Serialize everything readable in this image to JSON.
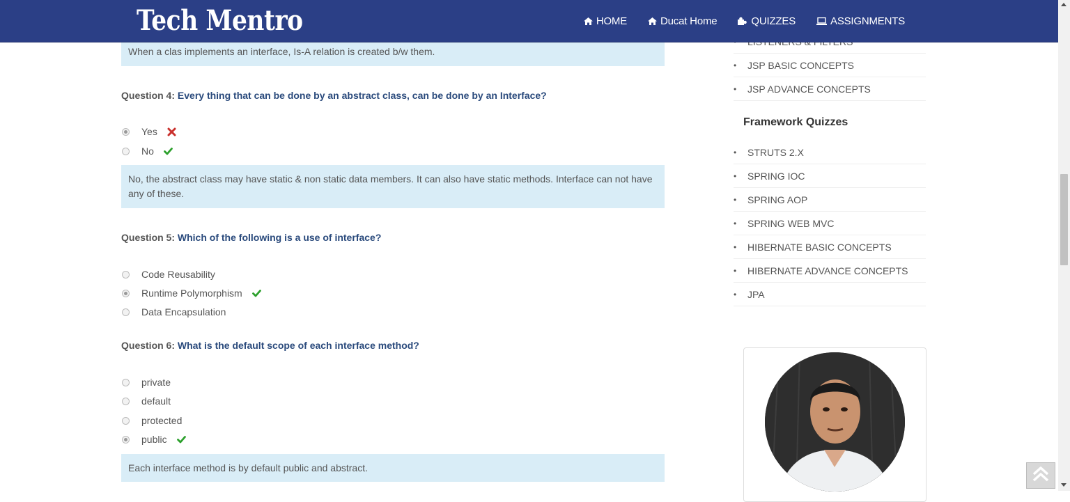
{
  "brand": "Tech Mentro",
  "nav": [
    {
      "label": "HOME",
      "icon": "home-icon"
    },
    {
      "label": "Ducat Home",
      "icon": "home-icon"
    },
    {
      "label": "QUIZZES",
      "icon": "puzzle-icon"
    },
    {
      "label": "ASSIGNMENTS",
      "icon": "laptop-icon"
    }
  ],
  "top_explanation": "When a clas implements an interface, Is-A relation is created b/w them.",
  "q4": {
    "num": "Question 4:",
    "text": "Every thing that can be done by an abstract class, can be done by an Interface?",
    "options": [
      {
        "label": "Yes",
        "selected": true,
        "result": "wrong"
      },
      {
        "label": "No",
        "selected": false,
        "result": "correct"
      }
    ],
    "explanation": "No, the abstract class may have static & non static data members. It can also have static methods. Interface can not have any of these."
  },
  "q5": {
    "num": "Question 5:",
    "text": "Which of the following is a use of interface?",
    "options": [
      {
        "label": "Code Reusability",
        "selected": false
      },
      {
        "label": "Runtime Polymorphism",
        "selected": true,
        "result": "correct"
      },
      {
        "label": "Data Encapsulation",
        "selected": false
      }
    ]
  },
  "q6": {
    "num": "Question 6:",
    "text": "What is the default scope of each interface method?",
    "options": [
      {
        "label": "private",
        "selected": false
      },
      {
        "label": "default",
        "selected": false
      },
      {
        "label": "protected",
        "selected": false
      },
      {
        "label": "public",
        "selected": true,
        "result": "correct"
      }
    ],
    "explanation": "Each interface method is by default public and abstract."
  },
  "sidebar": {
    "top_items": [
      "LISTENERS & FILTERS",
      "JSP BASIC CONCEPTS",
      "JSP ADVANCE CONCEPTS"
    ],
    "framework_heading": "Framework Quizzes",
    "framework_items": [
      "STRUTS 2.X",
      "SPRING IOC",
      "SPRING AOP",
      "SPRING WEB MVC",
      "HIBERNATE BASIC CONCEPTS",
      "HIBERNATE ADVANCE CONCEPTS",
      "JPA"
    ]
  },
  "colors": {
    "navbar": "#2b3f86",
    "question_text": "#2a4a7c",
    "explanation_bg": "#d9edf7",
    "correct": "#2ca02c",
    "wrong": "#c9302c"
  }
}
